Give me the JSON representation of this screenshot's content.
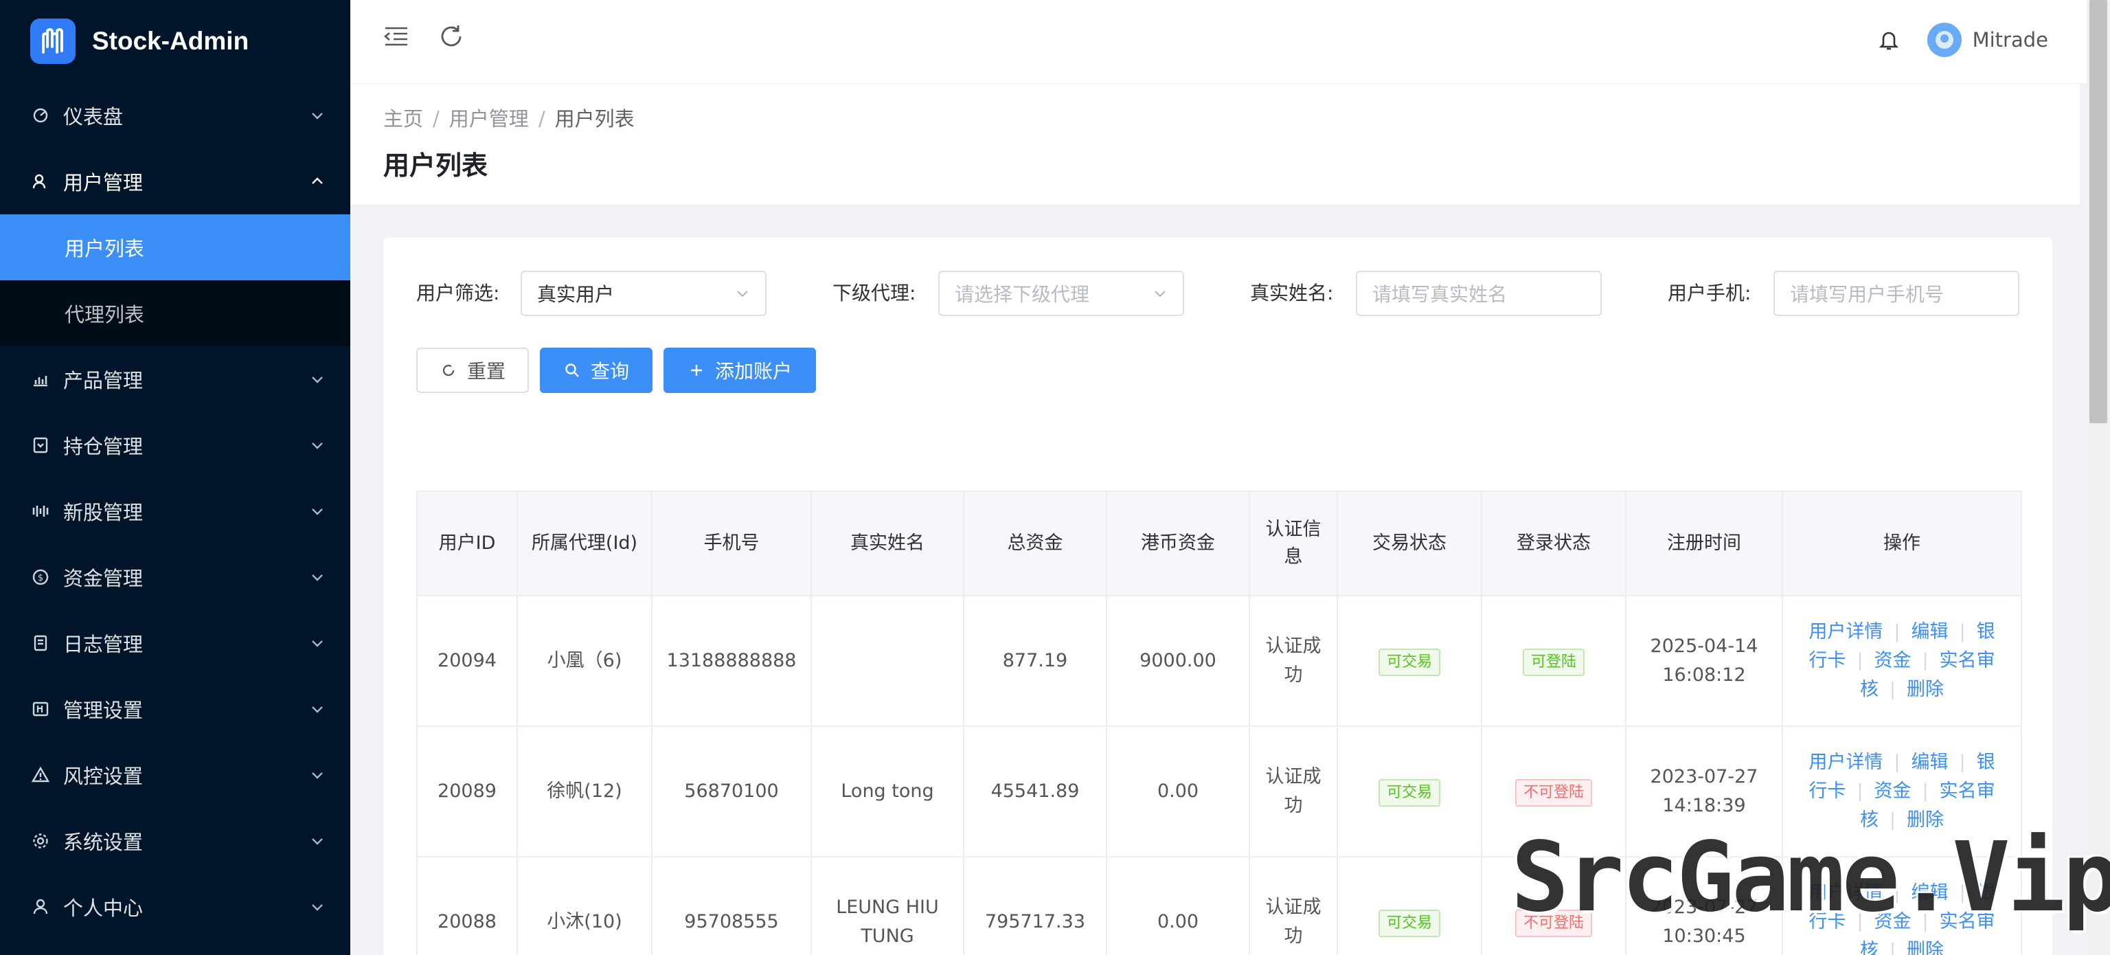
{
  "app": {
    "title": "Stock-Admin",
    "user": "Mitrade"
  },
  "sidebar": {
    "items": [
      {
        "label": "仪表盘",
        "icon": "dashboard-icon"
      },
      {
        "label": "用户管理",
        "icon": "user-group-icon",
        "expanded": true,
        "children": [
          {
            "label": "用户列表",
            "active": true
          },
          {
            "label": "代理列表"
          }
        ]
      },
      {
        "label": "产品管理",
        "icon": "bar-chart-icon"
      },
      {
        "label": "持仓管理",
        "icon": "position-icon"
      },
      {
        "label": "新股管理",
        "icon": "ipo-icon"
      },
      {
        "label": "资金管理",
        "icon": "money-icon"
      },
      {
        "label": "日志管理",
        "icon": "log-icon"
      },
      {
        "label": "管理设置",
        "icon": "admin-settings-icon"
      },
      {
        "label": "风控设置",
        "icon": "risk-warning-icon"
      },
      {
        "label": "系统设置",
        "icon": "gear-icon"
      },
      {
        "label": "个人中心",
        "icon": "person-icon"
      }
    ]
  },
  "breadcrumb": {
    "home": "主页",
    "parent": "用户管理",
    "current": "用户列表"
  },
  "page": {
    "title": "用户列表"
  },
  "filters": {
    "user_filter": {
      "label": "用户筛选:",
      "value": "真实用户"
    },
    "agent": {
      "label": "下级代理:",
      "placeholder": "请选择下级代理"
    },
    "real_name": {
      "label": "真实姓名:",
      "placeholder": "请填写真实姓名"
    },
    "phone": {
      "label": "用户手机:",
      "placeholder": "请填写用户手机号"
    }
  },
  "buttons": {
    "reset": "重置",
    "search": "查询",
    "add": "添加账户"
  },
  "table": {
    "headers": [
      "用户ID",
      "所属代理(Id)",
      "手机号",
      "真实姓名",
      "总资金",
      "港币资金",
      "认证信息",
      "交易状态",
      "登录状态",
      "注册时间",
      "操作"
    ],
    "rows": [
      {
        "id": "20094",
        "agent": "小凰（6)",
        "phone": "13188888888",
        "name": "",
        "total": "877.19",
        "hkd": "9000.00",
        "auth": "认证成功",
        "trade": "可交易",
        "login": "可登陆",
        "reg_date": "2025-04-14",
        "reg_time": "16:08:12"
      },
      {
        "id": "20089",
        "agent": "徐帆(12)",
        "phone": "56870100",
        "name": "Long tong",
        "total": "45541.89",
        "hkd": "0.00",
        "auth": "认证成功",
        "trade": "可交易",
        "login": "不可登陆",
        "reg_date": "2023-07-27",
        "reg_time": "14:18:39"
      },
      {
        "id": "20088",
        "agent": "小沐(10)",
        "phone": "95708555",
        "name": "LEUNG HIU TUNG",
        "total": "795717.33",
        "hkd": "0.00",
        "auth": "认证成功",
        "trade": "可交易",
        "login": "不可登陆",
        "reg_date": "2023-07-27",
        "reg_time": "10:30:45"
      }
    ],
    "ops": {
      "detail": "用户详情",
      "edit": "编辑",
      "bank": "银行卡",
      "fund": "资金",
      "kyc": "实名审核",
      "delete": "删除"
    }
  },
  "watermark": "SrcGame.Vip",
  "colors": {
    "sidebar_bg": "#001529",
    "accent": "#3b8ff6",
    "ok": "#52c41a",
    "danger": "#f56c6c"
  }
}
